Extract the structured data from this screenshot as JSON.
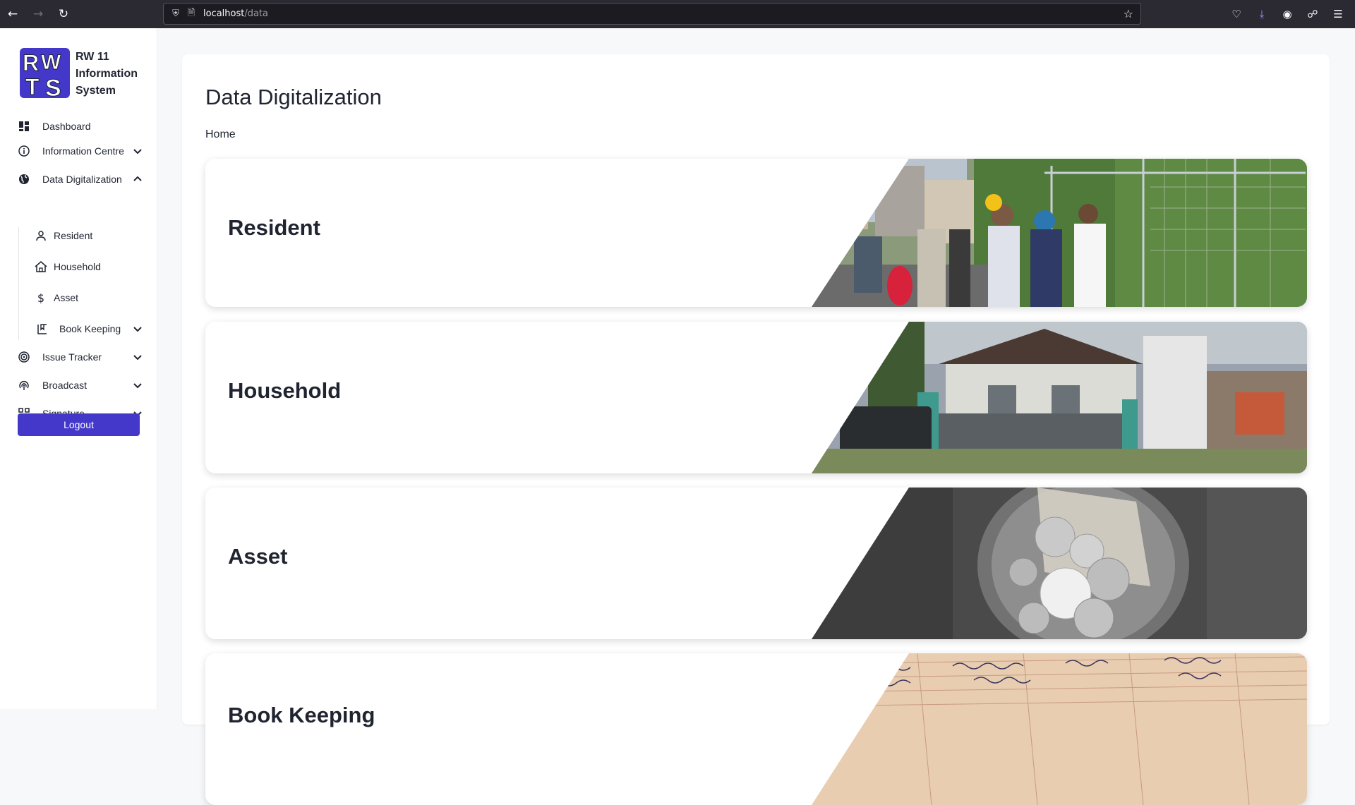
{
  "browser": {
    "url_host": "localhost",
    "url_path": "/data"
  },
  "brand": {
    "logo_text": "RWTS",
    "title": "RW 11 Information System"
  },
  "sidebar": {
    "items": [
      {
        "label": "Dashboard",
        "icon": "dashboard-icon"
      },
      {
        "label": "Information Centre",
        "icon": "info-icon"
      },
      {
        "label": "Data Digitalization",
        "icon": "globe-icon",
        "expanded": true
      },
      {
        "label": "Resident",
        "icon": "person-icon"
      },
      {
        "label": "Household",
        "icon": "home-icon"
      },
      {
        "label": "Asset",
        "icon": "dollar-icon"
      },
      {
        "label": "Book Keeping",
        "icon": "book-icon"
      },
      {
        "label": "Issue Tracker",
        "icon": "target-icon"
      },
      {
        "label": "Broadcast",
        "icon": "broadcast-icon"
      },
      {
        "label": "Signature",
        "icon": "qr-icon"
      }
    ],
    "logout_label": "Logout"
  },
  "main": {
    "title": "Data Digitalization",
    "breadcrumb": "Home",
    "cards": [
      {
        "title": "Resident",
        "image": "street-crowd-photo"
      },
      {
        "title": "Household",
        "image": "house-photo"
      },
      {
        "title": "Asset",
        "image": "coins-jar-photo"
      },
      {
        "title": "Book Keeping",
        "image": "ledger-photo"
      }
    ]
  },
  "colors": {
    "accent": "#4338ca",
    "text": "#1f2430",
    "background": "#f7f8fa"
  }
}
